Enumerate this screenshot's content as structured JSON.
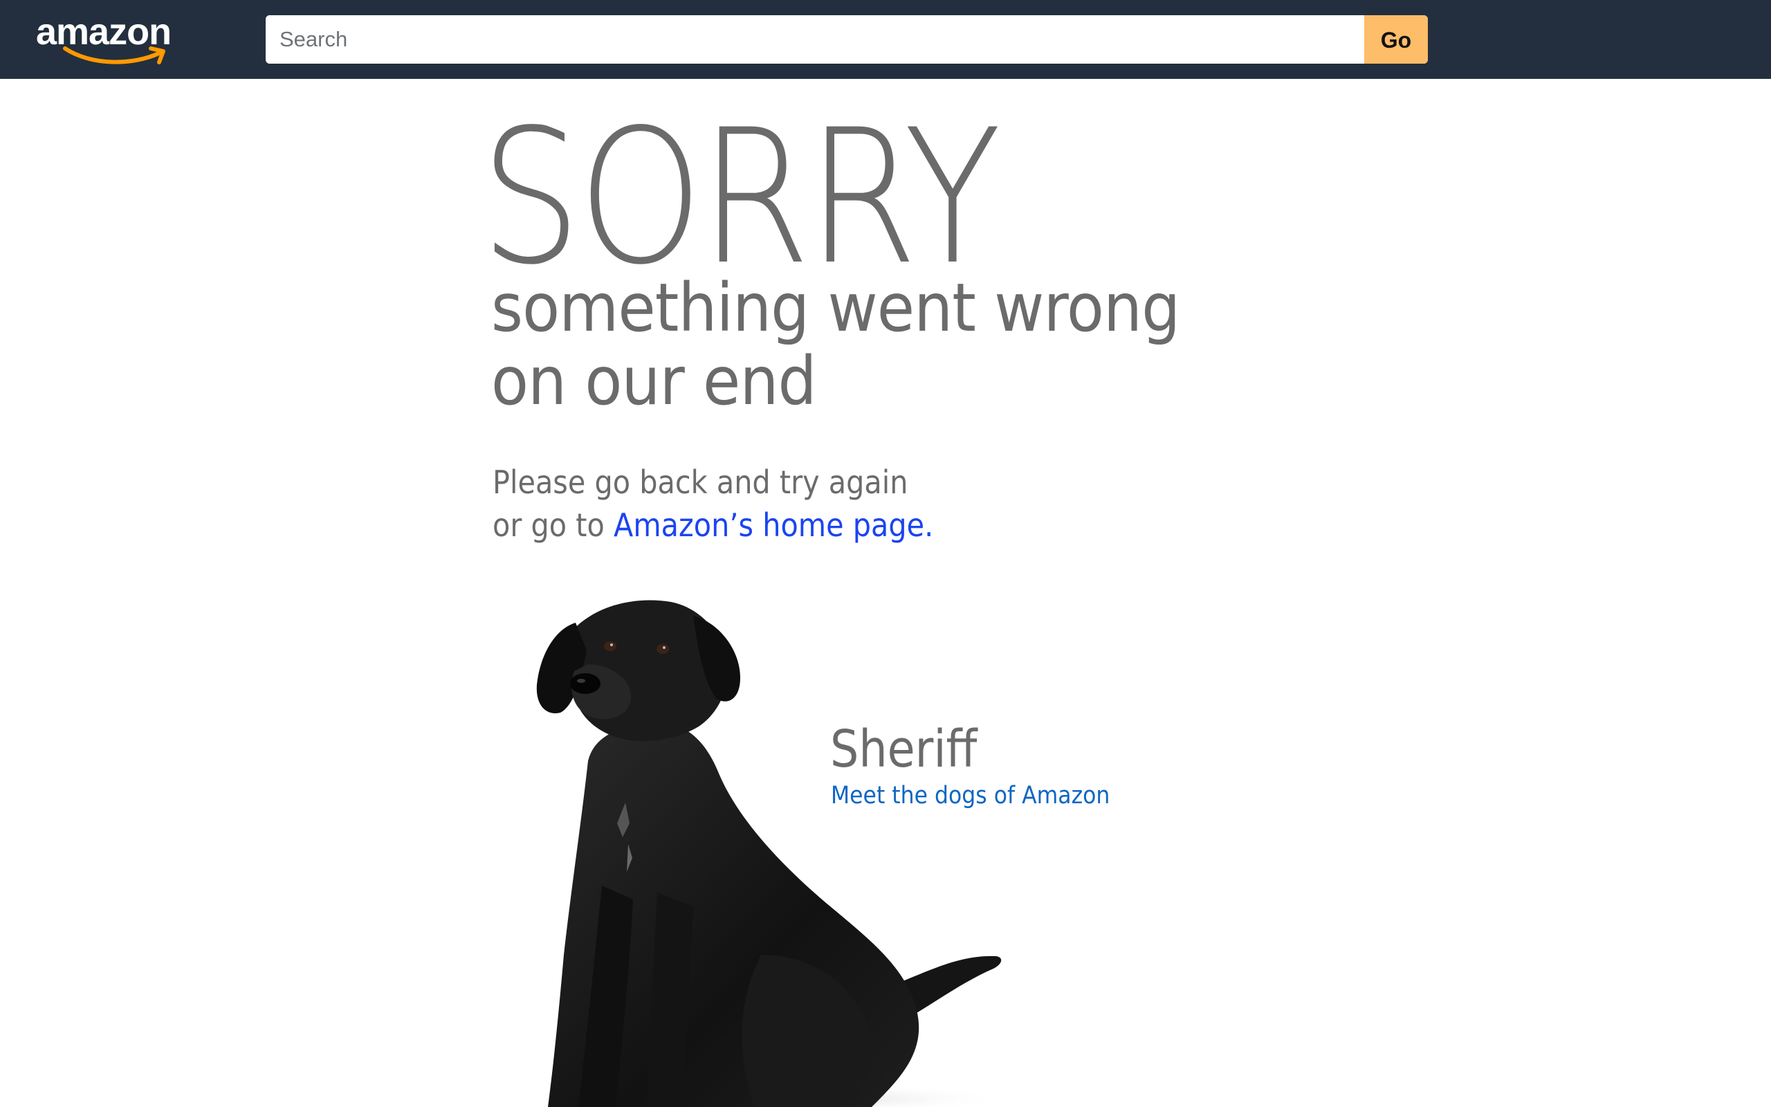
{
  "header": {
    "logo_text": "amazon",
    "search": {
      "placeholder": "Search",
      "value": ""
    },
    "go_label": "Go"
  },
  "error": {
    "title": "SORRY",
    "headline_line1": "something went wrong",
    "headline_line2": "on our end",
    "message_line1": "Please go back and try again",
    "message_line2_prefix": "or go to ",
    "home_link": "Amazon’s home page."
  },
  "dog": {
    "name": "Sheriff",
    "link": "Meet the dogs of Amazon"
  },
  "colors": {
    "nav_bg": "#232f3e",
    "go_button": "#febd69",
    "logo_smile": "#ff9900",
    "text_gray": "#6b6b6b",
    "home_link": "#1b44f0",
    "dog_link": "#0f66c3"
  }
}
